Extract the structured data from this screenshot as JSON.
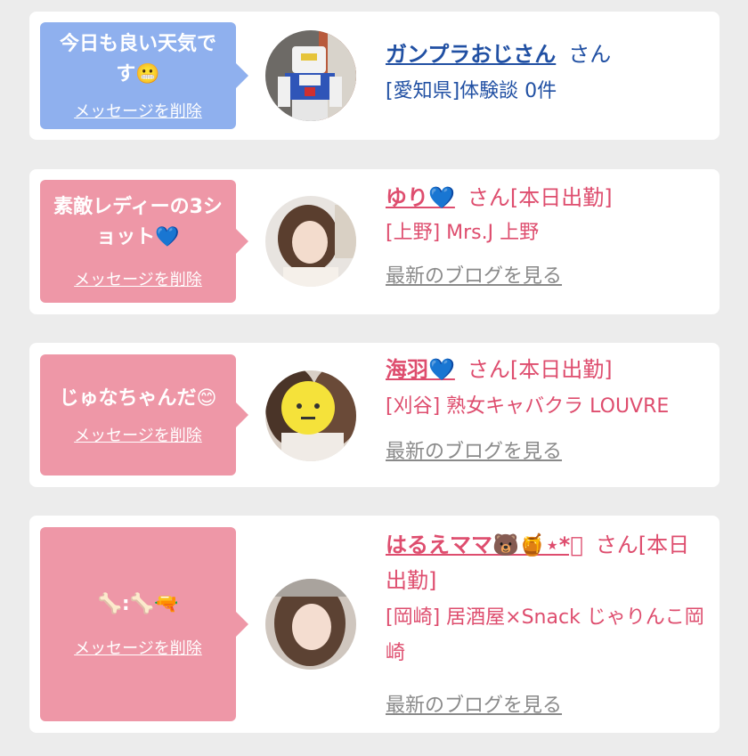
{
  "cards": [
    {
      "message": "今日も良い天気です😬",
      "delete_label": "メッセージを削除",
      "name": "ガンプラおじさん",
      "honorific": "さん",
      "status": "",
      "detail": "[愛知県]体験談 0件",
      "blog_label": "",
      "theme": "blue",
      "accent": "#2150a3",
      "bubble_color": "#8fb0ee"
    },
    {
      "message": "素敵レディーの3ショット💙",
      "delete_label": "メッセージを削除",
      "name": "ゆり💙",
      "honorific": "さん",
      "status": "[本日出勤]",
      "detail": "[上野] Mrs.J 上野",
      "blog_label": "最新のブログを見る",
      "theme": "pink",
      "accent": "#de4d6e",
      "bubble_color": "#ee97a7"
    },
    {
      "message": "じゅなちゃんだ😊",
      "delete_label": "メッセージを削除",
      "name": "海羽💙",
      "honorific": "さん",
      "status": "[本日出勤]",
      "detail": "[刈谷] 熟女キャバクラ LOUVRE",
      "blog_label": "最新のブログを見る",
      "theme": "pink",
      "accent": "#de4d6e",
      "bubble_color": "#ee97a7"
    },
    {
      "message": "🦴:🦴🔫",
      "delete_label": "メッセージを削除",
      "name": "はるえママ🐻🍯⋆*ﾟ",
      "honorific": "さん",
      "status": "[本日出勤]",
      "detail": "[岡崎] 居酒屋×Snack じゃりんこ岡崎",
      "blog_label": "最新のブログを見る",
      "theme": "pink",
      "accent": "#de4d6e",
      "bubble_color": "#ee97a7"
    }
  ]
}
